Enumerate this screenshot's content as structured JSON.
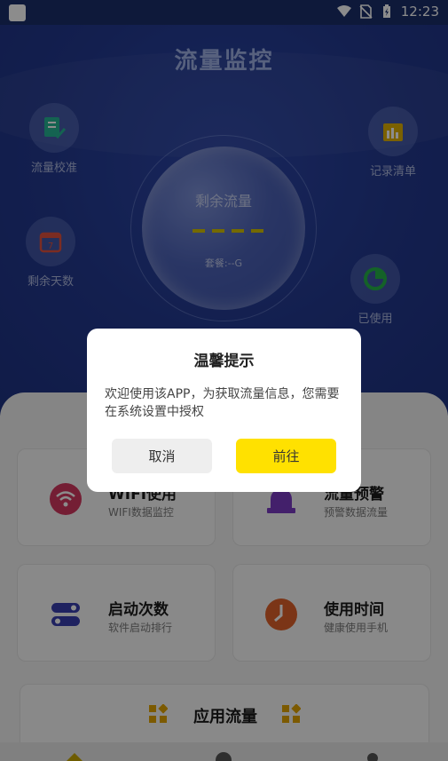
{
  "status": {
    "time": "12:23"
  },
  "hero": {
    "title": "流量监控",
    "calibrate": "流量校准",
    "days_left": "剩余天数",
    "records": "记录清单",
    "used": "已使用",
    "remaining_label": "剩余流量",
    "plan": "套餐:--G"
  },
  "cards": [
    {
      "title": "WIFI使用",
      "subtitle": "WIFI数据监控"
    },
    {
      "title": "流量预警",
      "subtitle": "预警数据流量"
    },
    {
      "title": "启动次数",
      "subtitle": "软件启动排行"
    },
    {
      "title": "使用时间",
      "subtitle": "健康使用手机"
    }
  ],
  "app_traffic": {
    "title": "应用流量"
  },
  "dialog": {
    "title": "温馨提示",
    "message": "欢迎使用该APP，为获取流量信息，您需要在系统设置中授权",
    "cancel": "取消",
    "confirm": "前往"
  },
  "colors": {
    "accent": "#ffe100",
    "hero_bg": "#23398f"
  }
}
